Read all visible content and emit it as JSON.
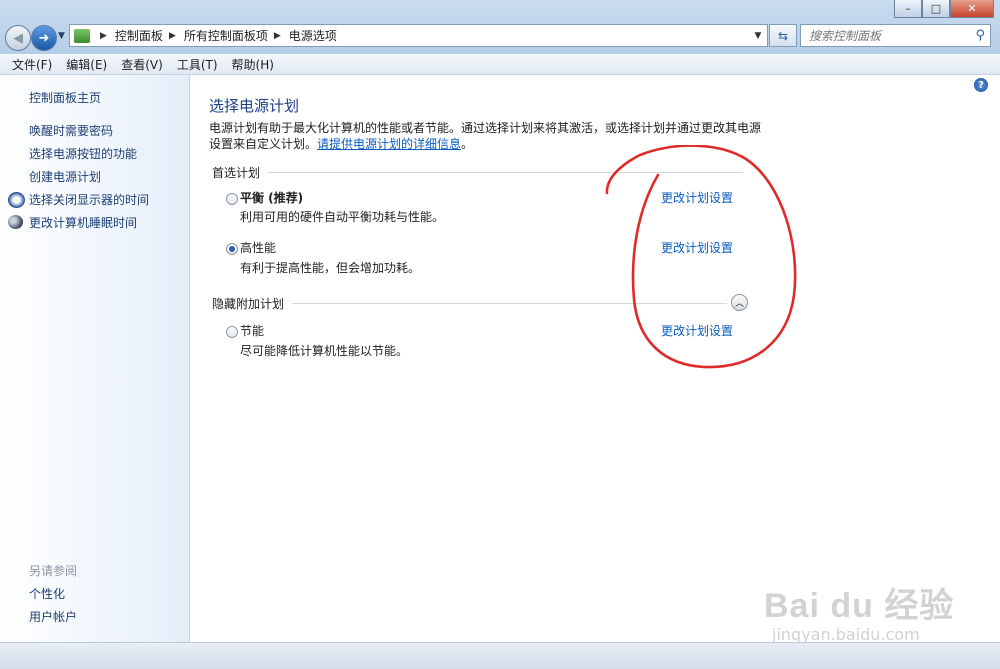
{
  "window": {
    "minimize_glyph": "–",
    "maximize_glyph": "□",
    "close_glyph": "✕"
  },
  "address_bar": {
    "breadcrumbs": [
      "控制面板",
      "所有控制面板项",
      "电源选项"
    ],
    "search_placeholder": "搜索控制面板"
  },
  "menu": {
    "items": [
      "文件(F)",
      "编辑(E)",
      "查看(V)",
      "工具(T)",
      "帮助(H)"
    ]
  },
  "sidebar": {
    "home": "控制面板主页",
    "links": [
      "唤醒时需要密码",
      "选择电源按钮的功能",
      "创建电源计划",
      "选择关闭显示器的时间",
      "更改计算机睡眠时间"
    ],
    "see_also_heading": "另请参阅",
    "see_also": [
      "个性化",
      "用户帐户"
    ]
  },
  "main": {
    "title": "选择电源计划",
    "description": "电源计划有助于最大化计算机的性能或者节能。通过选择计划来将其激活，或选择计划并通过更改其电源设置来自定义计划。",
    "description_link": "请提供电源计划的详细信息",
    "description_end": "。",
    "preferred_heading": "首选计划",
    "hidden_heading": "隐藏附加计划",
    "plans": [
      {
        "name": "平衡 (推荐)",
        "desc": "利用可用的硬件自动平衡功耗与性能。",
        "link": "更改计划设置",
        "selected": false
      },
      {
        "name": "高性能",
        "desc": "有利于提高性能，但会增加功耗。",
        "link": "更改计划设置",
        "selected": true
      },
      {
        "name": "节能",
        "desc": "尽可能降低计算机性能以节能。",
        "link": "更改计划设置",
        "selected": false
      }
    ]
  },
  "watermark": {
    "logo": "Bai du 经验",
    "url": "jingyan.baidu.com"
  },
  "colors": {
    "link": "#0a5cc2",
    "title": "#1e3f8a",
    "annotation": "#e02a2a"
  }
}
